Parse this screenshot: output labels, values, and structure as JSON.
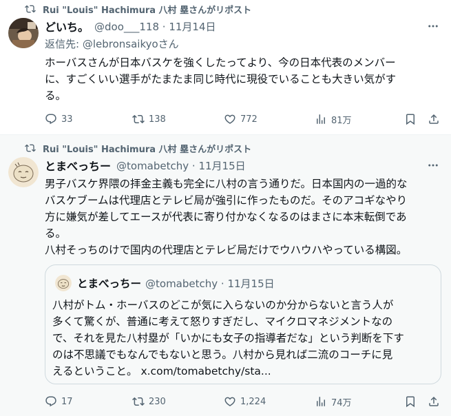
{
  "posts": [
    {
      "repost_label": "Rui \"Louis\" Hachimura 八村 塁さんがリポスト",
      "author_name": "どいち。",
      "author_meta": "@doo___118 · 11月14日",
      "reply_prefix": "返信先: ",
      "reply_handle": "@lebronsaikyo",
      "reply_suffix": "さん",
      "text_lines": [
        "ホーバスさんが日本バスケを強くしたってより、今の日本代表のメンバー",
        "に、すごくいい選手がたまたま同じ時代に現役でいることも大きい気がす",
        "る。"
      ],
      "replies": "33",
      "reposts": "138",
      "likes": "772",
      "views": "81万"
    },
    {
      "repost_label": "Rui \"Louis\" Hachimura 八村 塁さんがリポスト",
      "author_name": "とまべっちー",
      "author_meta": "@tomabetchy · 11月15日",
      "text_lines": [
        "男子バスケ界隈の拝金主義も完全に八村の言う通りだ。日本国内の一過的な",
        "バスケブームは代理店とテレビ局が強引に作ったものだ。そのアコギなやり",
        "方に嫌気が差してエースが代表に寄り付かなくなるのはまさに本末転倒であ",
        "る。",
        "八村そっちのけで国内の代理店とテレビ局だけでウハウハやっている構図。"
      ],
      "quote": {
        "author_name": "とまべっちー",
        "author_meta": "@tomabetchy · 11月15日",
        "text_lines": [
          "八村がトム・ホーバスのどこが気に入らないのか分からないと言う人が",
          "多くて驚くが、普通に考えて怒りすぎだし、マイクロマネジメントなの",
          "で、それを見た八村塁が「いかにも女子の指導者だな」という判断を下す",
          "のは不思議でもなんでもないと思う。八村から見れば二流のコーチに見",
          "えるということ。 x.com/tomabetchy/sta..."
        ]
      },
      "replies": "17",
      "reposts": "230",
      "likes": "1,224",
      "views": "74万"
    }
  ],
  "icons": {
    "repost": "repost-icon",
    "reply": "reply-icon",
    "like": "heart-icon",
    "views": "views-chart-icon",
    "bookmark": "bookmark-icon",
    "share": "share-icon",
    "more": "more-dots-icon"
  },
  "colors": {
    "text": "#0f1419",
    "secondary": "#536471",
    "border": "#cfd9de",
    "highlight_bg": "#f7f9f9"
  }
}
